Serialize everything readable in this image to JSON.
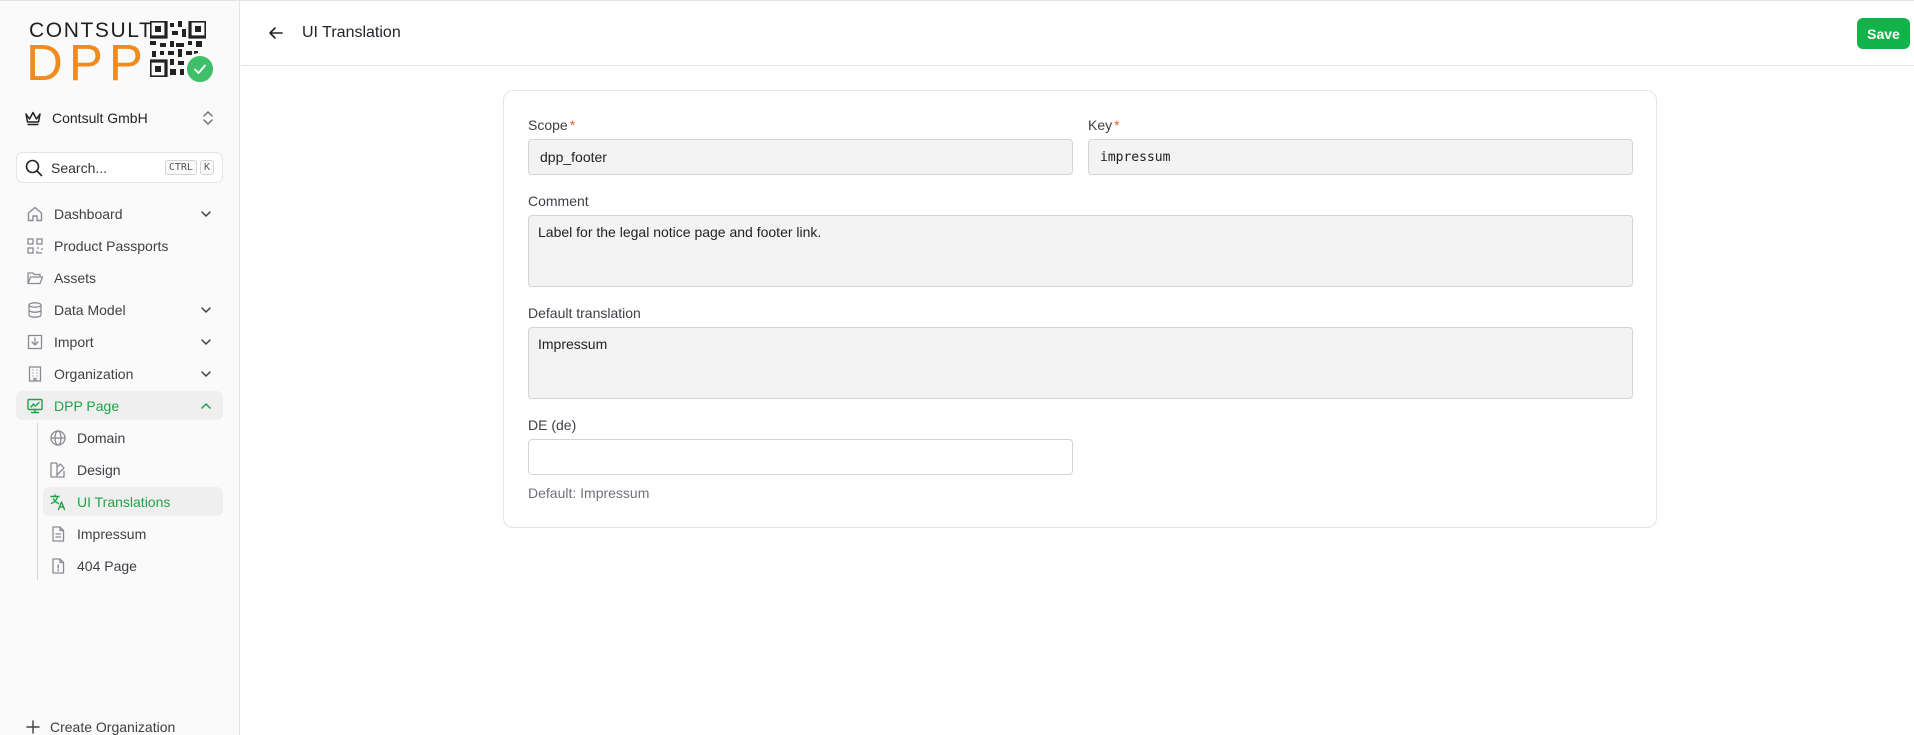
{
  "brand": {
    "word1": "CONTSULT",
    "word2": "DPP",
    "accent_color": "#f18b1f",
    "check_color": "#3fbf6a"
  },
  "org_switcher": {
    "name": "Contsult GmbH",
    "icon": "crown-icon"
  },
  "search": {
    "placeholder": "Search...",
    "kbd1": "CTRL",
    "kbd2": "K"
  },
  "sidebar": {
    "items": [
      {
        "label": "Dashboard",
        "icon": "home-icon",
        "expandable": true
      },
      {
        "label": "Product Passports",
        "icon": "qr-grid-icon",
        "expandable": false
      },
      {
        "label": "Assets",
        "icon": "folder-open-icon",
        "expandable": false
      },
      {
        "label": "Data Model",
        "icon": "database-icon",
        "expandable": true
      },
      {
        "label": "Import",
        "icon": "import-icon",
        "expandable": true
      },
      {
        "label": "Organization",
        "icon": "building-icon",
        "expandable": true
      },
      {
        "label": "DPP Page",
        "icon": "monitor-icon",
        "expandable": true,
        "expanded": true,
        "active": true
      }
    ],
    "subitems": [
      {
        "label": "Domain",
        "icon": "globe-icon"
      },
      {
        "label": "Design",
        "icon": "palette-icon"
      },
      {
        "label": "UI Translations",
        "icon": "translate-icon",
        "active": true
      },
      {
        "label": "Impressum",
        "icon": "file-text-icon"
      },
      {
        "label": "404 Page",
        "icon": "file-alert-icon"
      }
    ],
    "create_org": "Create Organization",
    "active_color": "#1fa34a"
  },
  "header": {
    "title": "UI Translation",
    "save_label": "Save",
    "save_color": "#12b34a"
  },
  "form": {
    "scope": {
      "label": "Scope",
      "value": "dpp_footer",
      "required": "*"
    },
    "key": {
      "label": "Key",
      "value": "impressum",
      "required": "*"
    },
    "comment": {
      "label": "Comment",
      "value": "Label for the legal notice page and footer link."
    },
    "default_translation": {
      "label": "Default translation",
      "value": "Impressum"
    },
    "de": {
      "label": "DE (de)",
      "value": "",
      "hint": "Default: Impressum"
    }
  }
}
